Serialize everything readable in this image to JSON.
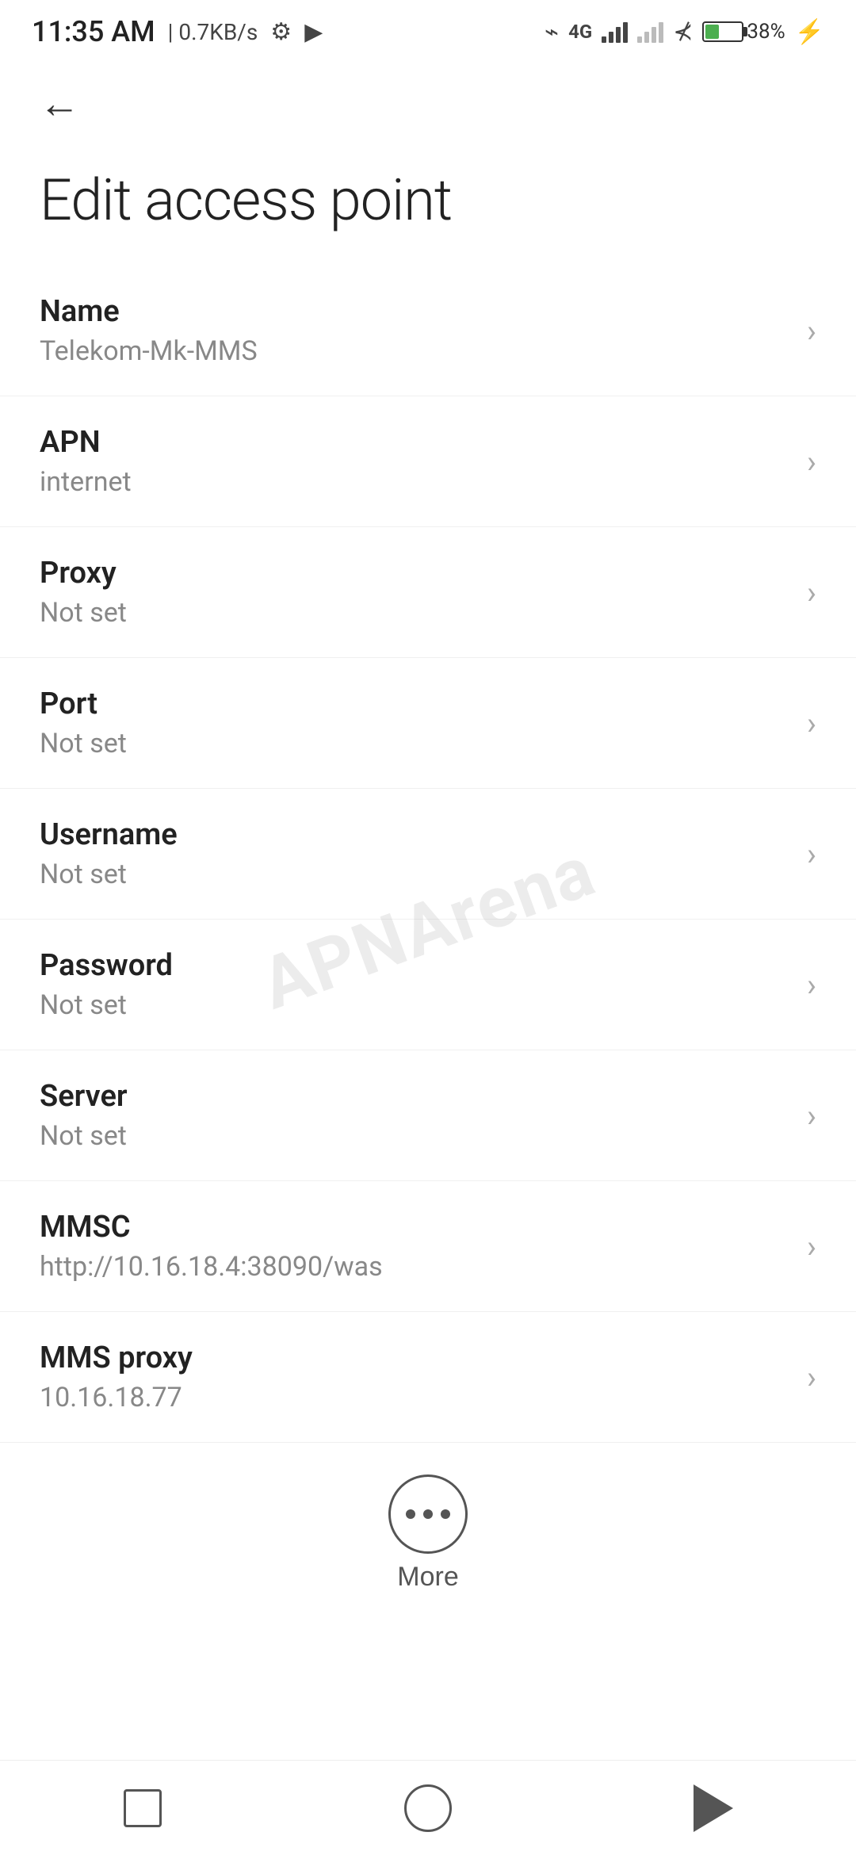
{
  "statusBar": {
    "time": "11:35 AM",
    "speed": "0.7KB/s",
    "battery": "38",
    "batteryPercent": "38%"
  },
  "header": {
    "backLabel": "←",
    "title": "Edit access point"
  },
  "settings": [
    {
      "label": "Name",
      "value": "Telekom-Mk-MMS"
    },
    {
      "label": "APN",
      "value": "internet"
    },
    {
      "label": "Proxy",
      "value": "Not set"
    },
    {
      "label": "Port",
      "value": "Not set"
    },
    {
      "label": "Username",
      "value": "Not set"
    },
    {
      "label": "Password",
      "value": "Not set"
    },
    {
      "label": "Server",
      "value": "Not set"
    },
    {
      "label": "MMSC",
      "value": "http://10.16.18.4:38090/was"
    },
    {
      "label": "MMS proxy",
      "value": "10.16.18.77"
    }
  ],
  "more": {
    "label": "More"
  },
  "watermark": "APNArena"
}
